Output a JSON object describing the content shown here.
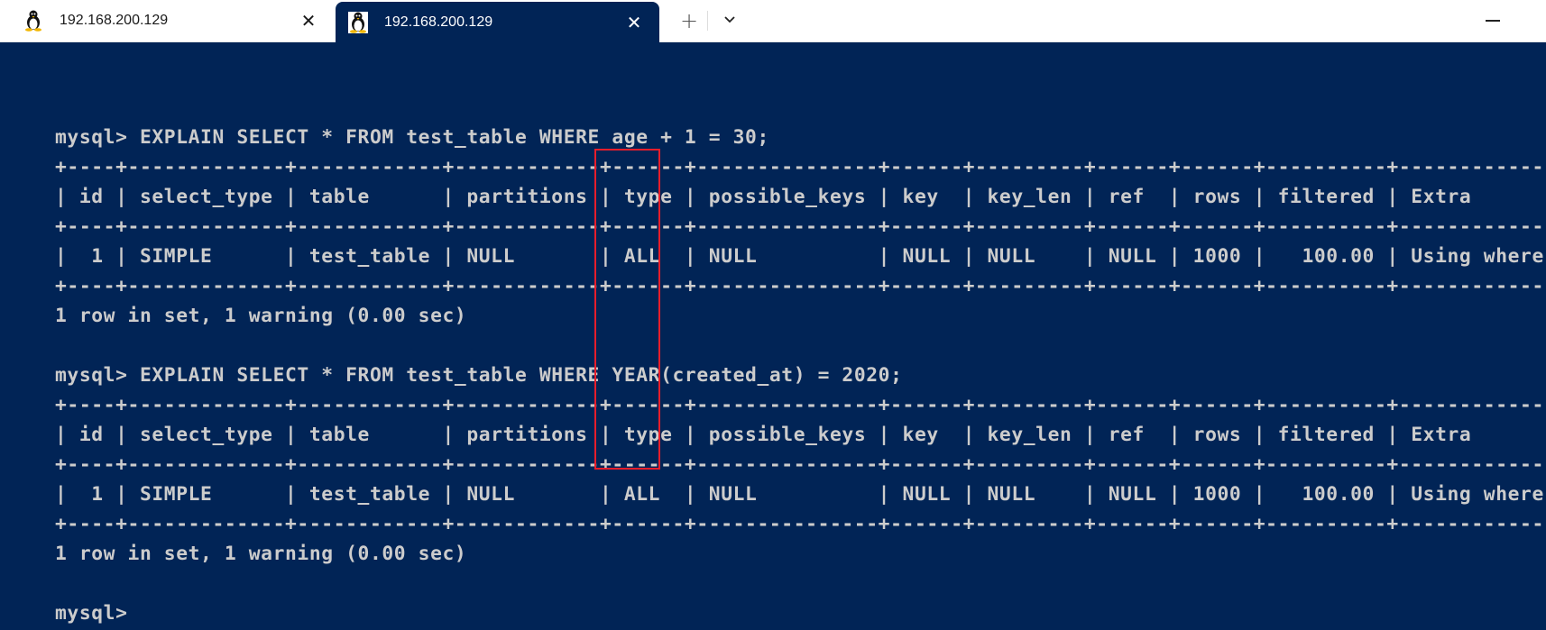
{
  "tabs": [
    {
      "title": "192.168.200.129",
      "icon": "linux-penguin-icon",
      "active": false,
      "close_label": "✕"
    },
    {
      "title": "192.168.200.129",
      "icon": "linux-penguin-icon",
      "active": true,
      "close_label": "✕"
    }
  ],
  "tabbar": {
    "new_tab_label": "+",
    "dropdown_label": "⌄"
  },
  "colors": {
    "terminal_bg": "#012456",
    "terminal_fg": "#cccccc",
    "highlight": "#e81e2b"
  },
  "terminal": {
    "lines": [
      "",
      "mysql> EXPLAIN SELECT * FROM test_table WHERE age + 1 = 30;",
      "+----+-------------+------------+------------+------+---------------+------+---------+------+------+----------+-------------+",
      "| id | select_type | table      | partitions | type | possible_keys | key  | key_len | ref  | rows | filtered | Extra       |",
      "+----+-------------+------------+------------+------+---------------+------+---------+------+------+----------+-------------+",
      "|  1 | SIMPLE      | test_table | NULL       | ALL  | NULL          | NULL | NULL    | NULL | 1000 |   100.00 | Using where |",
      "+----+-------------+------------+------------+------+---------------+------+---------+------+------+----------+-------------+",
      "1 row in set, 1 warning (0.00 sec)",
      "",
      "mysql> EXPLAIN SELECT * FROM test_table WHERE YEAR(created_at) = 2020;",
      "+----+-------------+------------+------------+------+---------------+------+---------+------+------+----------+-------------+",
      "| id | select_type | table      | partitions | type | possible_keys | key  | key_len | ref  | rows | filtered | Extra       |",
      "+----+-------------+------------+------------+------+---------------+------+---------+------+------+----------+-------------+",
      "|  1 | SIMPLE      | test_table | NULL       | ALL  | NULL          | NULL | NULL    | NULL | 1000 |   100.00 | Using where |",
      "+----+-------------+------------+------------+------+---------------+------+---------+------+------+----------+-------------+",
      "1 row in set, 1 warning (0.00 sec)",
      "",
      "mysql> "
    ],
    "queries": [
      {
        "command": "EXPLAIN SELECT * FROM test_table WHERE age + 1 = 30;",
        "columns": [
          "id",
          "select_type",
          "table",
          "partitions",
          "type",
          "possible_keys",
          "key",
          "key_len",
          "ref",
          "rows",
          "filtered",
          "Extra"
        ],
        "rows": [
          [
            "1",
            "SIMPLE",
            "test_table",
            "NULL",
            "ALL",
            "NULL",
            "NULL",
            "NULL",
            "NULL",
            "1000",
            "100.00",
            "Using where"
          ]
        ],
        "summary": "1 row in set, 1 warning (0.00 sec)"
      },
      {
        "command": "EXPLAIN SELECT * FROM test_table WHERE YEAR(created_at) = 2020;",
        "columns": [
          "id",
          "select_type",
          "table",
          "partitions",
          "type",
          "possible_keys",
          "key",
          "key_len",
          "ref",
          "rows",
          "filtered",
          "Extra"
        ],
        "rows": [
          [
            "1",
            "SIMPLE",
            "test_table",
            "NULL",
            "ALL",
            "NULL",
            "NULL",
            "NULL",
            "NULL",
            "1000",
            "100.00",
            "Using where"
          ]
        ],
        "summary": "1 row in set, 1 warning (0.00 sec)"
      }
    ],
    "prompt": "mysql>",
    "highlighted_column": "type"
  }
}
